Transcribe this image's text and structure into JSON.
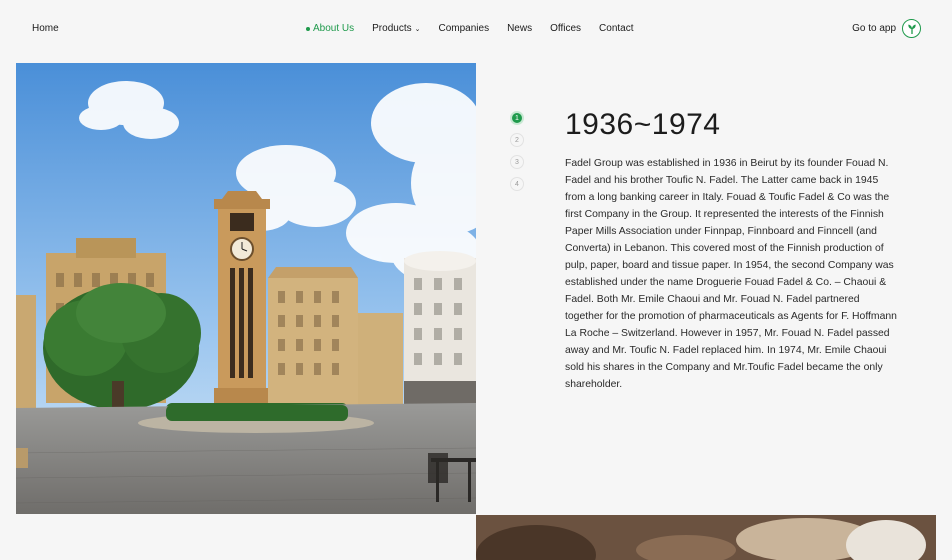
{
  "nav": {
    "home": "Home",
    "links": [
      {
        "label": "About Us",
        "active": true
      },
      {
        "label": "Products",
        "dropdown": true
      },
      {
        "label": "Companies"
      },
      {
        "label": "News"
      },
      {
        "label": "Offices"
      },
      {
        "label": "Contact"
      }
    ],
    "go_to_app": "Go to app",
    "app_icon": "leaf-logo-icon"
  },
  "timeline": {
    "steps": [
      "1",
      "2",
      "3",
      "4"
    ],
    "active_step": 1
  },
  "content": {
    "title": "1936~1974",
    "body": "Fadel Group was established in 1936 in Beirut by its founder Fouad N. Fadel and his brother Toufic N. Fadel. The Latter came back in 1945 from a long banking career in Italy. Fouad & Toufic Fadel & Co was the first Company in the Group. It represented the interests of the Finnish Paper Mills Association under Finnpap, Finnboard and Finncell (and Converta) in Lebanon. This covered most of the Finnish production of pulp, paper, board and tissue paper. In 1954, the second Company was established under the name Droguerie Fouad Fadel & Co. – Chaoui & Fadel. Both Mr. Emile Chaoui and Mr. Fouad N. Fadel partnered together for the promotion of pharmaceuticals as Agents for F. Hoffmann La Roche – Switzerland. However in 1957, Mr. Fouad N. Fadel passed away and Mr. Toufic N. Fadel replaced him. In 1974, Mr. Emile Chaoui sold his shares in the Company and Mr.Toufic Fadel became the only shareholder."
  },
  "colors": {
    "accent": "#1f9a4c",
    "background": "#f6f6f6",
    "text": "#1c1c1c"
  }
}
